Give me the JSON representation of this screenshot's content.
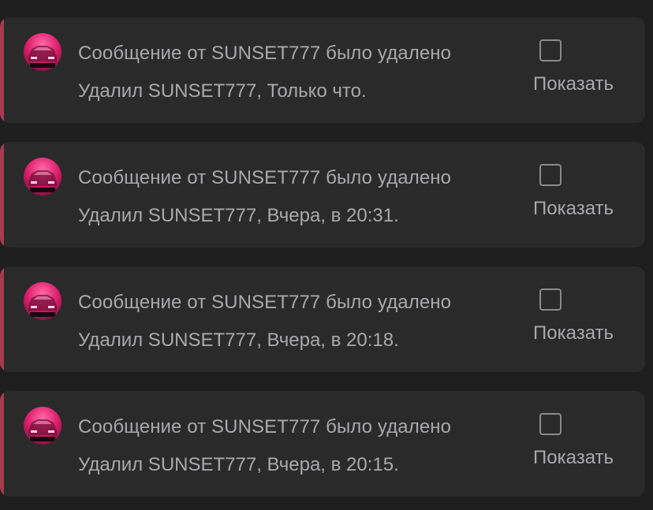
{
  "notifications": [
    {
      "title": "Сообщение от SUNSET777 было удалено",
      "meta": "Удалил SUNSET777, Только что.",
      "show_label": "Показать",
      "checked": false
    },
    {
      "title": "Сообщение от SUNSET777 было удалено",
      "meta": "Удалил SUNSET777, Вчера, в 20:31.",
      "show_label": "Показать",
      "checked": false
    },
    {
      "title": "Сообщение от SUNSET777 было удалено",
      "meta": "Удалил SUNSET777, Вчера, в 20:18.",
      "show_label": "Показать",
      "checked": false
    },
    {
      "title": "Сообщение от SUNSET777 было удалено",
      "meta": "Удалил SUNSET777, Вчера, в 20:15.",
      "show_label": "Показать",
      "checked": false
    }
  ],
  "colors": {
    "background": "#1e1e1f",
    "card": "#2a2a2b",
    "accent": "#a83a4e",
    "text": "#a9a9ab",
    "checkbox_border": "#8a8a8c",
    "avatar": "#e0206e"
  }
}
